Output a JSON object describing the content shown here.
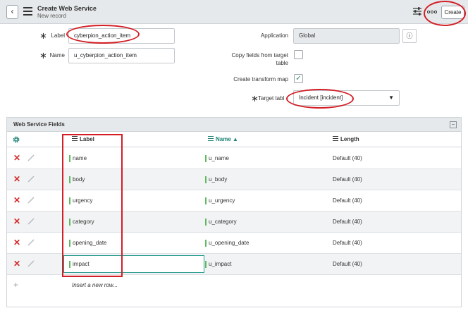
{
  "header": {
    "back_glyph": "‹",
    "title": "Create Web Service",
    "subtitle": "New record",
    "create_label": "Create"
  },
  "form": {
    "label_label": "Label",
    "label_value": "cyberpion_action_item",
    "name_label": "Name",
    "name_value": "u_cyberpion_action_item",
    "application_label": "Application",
    "application_value": "Global",
    "copy_fields_label_1": "Copy fields from target",
    "copy_fields_label_2": "table",
    "create_transform_label": "Create transform map",
    "create_transform_checked": true,
    "target_table_label": "Target tabl",
    "target_table_value": "Incident [incident]",
    "required_glyph": "∗",
    "info_glyph": "ⓘ",
    "check_glyph": "✓",
    "dropdown_glyph": "▼"
  },
  "section": {
    "title": "Web Service Fields",
    "collapse_glyph": "−",
    "columns": {
      "label": "Label",
      "name": "Name",
      "length": "Length",
      "sort_glyph": "▲"
    },
    "rows": [
      {
        "label": "name",
        "name": "u_name",
        "length": "Default (40)"
      },
      {
        "label": "body",
        "name": "u_body",
        "length": "Default (40)"
      },
      {
        "label": "urgency",
        "name": "u_urgency",
        "length": "Default (40)"
      },
      {
        "label": "category",
        "name": "u_category",
        "length": "Default (40)"
      },
      {
        "label": "opening_date",
        "name": "u_opening_date",
        "length": "Default (40)"
      },
      {
        "label": "impact",
        "name": "u_impact",
        "length": "Default (40)"
      }
    ],
    "delete_glyph": "✕",
    "plus_glyph": "+",
    "insert_text": "Insert a new row..."
  },
  "colors": {
    "accent": "#1f8476",
    "delete": "#d42b2b",
    "annotation": "#d31f26",
    "field_marker": "#5dbb5d",
    "header_bg": "#e6e9eb"
  },
  "icons": {
    "back": "chevron-left-icon",
    "menu": "hamburger-icon",
    "settings": "sliders-icon",
    "more": "more-icon",
    "info": "info-icon",
    "gear": "gear-icon",
    "delete": "delete-icon",
    "edit": "pencil-icon",
    "add": "plus-icon"
  }
}
